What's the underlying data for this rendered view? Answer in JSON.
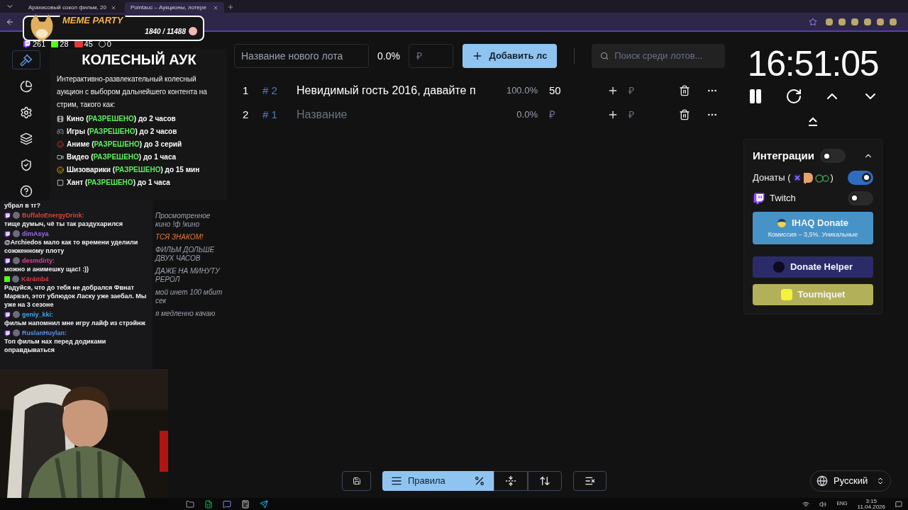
{
  "browser": {
    "tabs": [
      {
        "title": "Арахисовый сокол фильм, 20",
        "selected": false
      },
      {
        "title": "Pointauc – Аукционы, лотере",
        "selected": true
      }
    ]
  },
  "meme_party": {
    "title": "MEME PARTY",
    "score": "1840 / 11488"
  },
  "stats": [
    {
      "kind": "twitch",
      "value": "261"
    },
    {
      "kind": "kick",
      "value": "28"
    },
    {
      "kind": "vk",
      "value": "45"
    },
    {
      "kind": "other",
      "value": "0"
    }
  ],
  "nav": [
    {
      "kind": "gavel",
      "selected": true
    },
    {
      "kind": "pie",
      "selected": false
    },
    {
      "kind": "settings",
      "selected": false
    },
    {
      "kind": "layers",
      "selected": false
    },
    {
      "kind": "shield",
      "selected": false
    },
    {
      "kind": "help",
      "selected": false
    }
  ],
  "rules": {
    "title": "КОЛЕСНЫЙ АУК",
    "intro": "Интерактивно-развлекательный колесный аукцион с выбором дальнейшего контента на стрим, такого как:",
    "items": [
      {
        "kind": "film",
        "label": "Кино (",
        "status": "РАЗРЕШЕНО",
        "rest": ") до 2 часов"
      },
      {
        "kind": "game",
        "label": "Игры (",
        "status": "РАЗРЕШЕНО",
        "rest": ") до 2 часов"
      },
      {
        "kind": "devil",
        "label": "Аниме (",
        "status": "РАЗРЕШЕНО",
        "rest": ") до 3 серий"
      },
      {
        "kind": "video",
        "label": "Видео (",
        "status": "РАЗРЕШЕНО",
        "rest": ") до 1 часа"
      },
      {
        "kind": "smile",
        "label": "Шизоварики (",
        "status": "РАЗРЕШЕНО",
        "rest": ") до 15 мин"
      },
      {
        "kind": "box",
        "label": "Хант (",
        "status": "РАЗРЕШЕНО",
        "rest": ") до 1  часа"
      }
    ]
  },
  "chat": [
    {
      "text": "убрал в тг?"
    },
    {
      "kind": "twitch",
      "user": "BuffaloEnergyDrink:",
      "color": "#e0403a",
      "text": "тище думыч, чё ты так раздухарился"
    },
    {
      "kind": "twitch",
      "user": "dimAsya",
      "color": "#9b6cf0",
      "text": "@Archiedos мало как то времени уделили сожженному плоту"
    },
    {
      "kind": "twitch",
      "user": "desmdirty:",
      "color": "#e0409a",
      "text": "можно и анимешку щас! :))"
    },
    {
      "kind": "kick",
      "user": "K4r4mb4",
      "color": "#d83a44",
      "text": "Радуйся, что до тебя не добрался Фвнат Марвэл, этот ублюдок Ласку уже заебал. Мы уже на 3 сезоне"
    },
    {
      "kind": "twitch",
      "user": "geniy_kki:",
      "color": "#3fa7e8",
      "text": "фильм напомнил мне игру лайф из стрэйнж"
    },
    {
      "kind": "twitch",
      "user": "RuslanHuylan:",
      "color": "#5b8ee0",
      "text": "Топ фильм нах перед додиками оправдываться"
    }
  ],
  "overlay_lines": [
    {
      "text": "Просмотренное кино !ф !кино",
      "color": "#9ca3af"
    },
    {
      "text": "ТСЯ ЗНАКОМ!",
      "color": "#e8763c"
    },
    {
      "text": "ФИЛЬМ ДОЛЬШЕ ДВУХ ЧАСОВ",
      "color": "#9ca3af"
    },
    {
      "text": "ДАЖЕ НА МИНУТУ РЕРОЛ",
      "color": "#9ca3af"
    },
    {
      "text": "мой инет 100 мбит сек",
      "color": "#9ca3af"
    },
    {
      "text": "я медленно качаю",
      "color": "#9ca3af"
    }
  ],
  "new_lot": {
    "name_placeholder": "Название нового лота",
    "percent": "0.0%",
    "amount_placeholder": "₽",
    "add_button": "Добавить лс"
  },
  "search": {
    "placeholder": "Поиск среди лотов..."
  },
  "lots": [
    {
      "index": "1",
      "id": "# 2",
      "name": "Невидимый гость 2016, давайте п",
      "percent": "100.0%",
      "amount": "50",
      "add_placeholder": "₽"
    },
    {
      "index": "2",
      "id": "# 1",
      "name_placeholder": "Название",
      "percent": "0.0%",
      "amount_placeholder": "₽",
      "add_placeholder": "₽"
    }
  ],
  "timer": {
    "time": "16:51:05"
  },
  "integrations": {
    "title": "Интеграции",
    "on": false,
    "expanded": true,
    "items": [
      {
        "kind": "donations",
        "label": "Донаты (",
        "suffix": ")",
        "on": true
      },
      {
        "kind": "twitch",
        "label": "Twitch",
        "on": false
      }
    ],
    "services": [
      {
        "kind": "ihaq",
        "name": "IHAQ Donate",
        "note": "Комиссия – 3,5%. Уникальные",
        "color": "#4793c7"
      },
      {
        "kind": "helper",
        "name": "Donate Helper",
        "color": "#2b2b6a"
      },
      {
        "kind": "tourniquet",
        "name": "Tourniquet",
        "color": "#b3b05a"
      }
    ]
  },
  "toolbar": {
    "rules_button": "Правила"
  },
  "language": {
    "value": "Русский"
  },
  "taskbar": {
    "lang": "ENG",
    "time": "3:15",
    "date": "11.04.2026"
  }
}
